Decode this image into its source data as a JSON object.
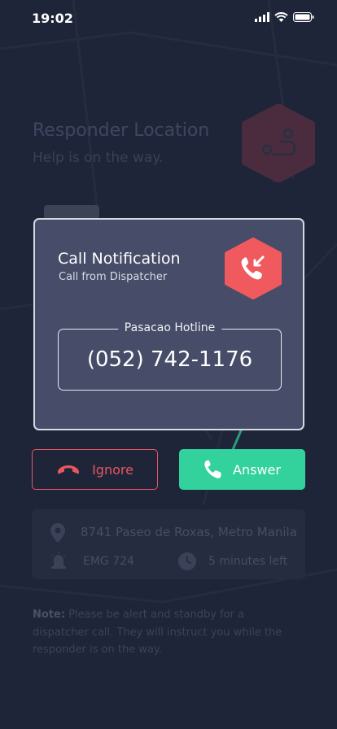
{
  "status_bar": {
    "time": "19:02"
  },
  "background": {
    "title": "Responder Location",
    "subtitle": "Help is on the way."
  },
  "modal": {
    "title": "Call Notification",
    "subtitle": "Call from Dispatcher",
    "hotline_label": "Pasacao Hotline",
    "hotline_number": "(052) 742-1176",
    "icon": "incoming-call-icon"
  },
  "actions": {
    "ignore_label": "Ignore",
    "answer_label": "Answer"
  },
  "info": {
    "address": "8741 Paseo de Roxas, Metro Manila",
    "unit": "EMG 724",
    "eta": "5 minutes left"
  },
  "note": {
    "label": "Note:",
    "text": "Please be alert and standby for a dispatcher call. They will instruct you while the responder is on the way."
  },
  "colors": {
    "background": "#1f2538",
    "modal": "#474d68",
    "accent_red": "#e85660",
    "accent_green": "#33d19b"
  }
}
